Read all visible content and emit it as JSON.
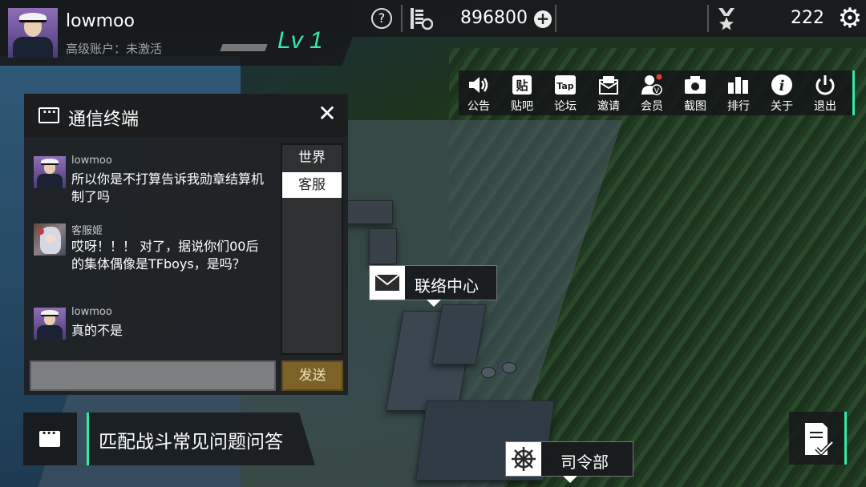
{
  "player": {
    "username": "lowmoo",
    "account_status": "高级账户：未激活",
    "level": "Lv 1"
  },
  "resources": {
    "help_label": "?",
    "coins": "896800",
    "medals": "222"
  },
  "menu": {
    "items": [
      {
        "label": "公告",
        "icon": "speaker-icon"
      },
      {
        "label": "贴吧",
        "icon": "tieba-icon"
      },
      {
        "label": "论坛",
        "icon": "taptap-icon"
      },
      {
        "label": "邀请",
        "icon": "invite-mail-icon"
      },
      {
        "label": "会员",
        "icon": "member-icon"
      },
      {
        "label": "截图",
        "icon": "camera-icon"
      },
      {
        "label": "排行",
        "icon": "ranking-icon"
      },
      {
        "label": "关于",
        "icon": "info-icon"
      },
      {
        "label": "退出",
        "icon": "power-icon"
      }
    ]
  },
  "chat": {
    "title": "通信终端",
    "close_label": "✕",
    "tabs": [
      "世界",
      "客服"
    ],
    "active_tab": "客服",
    "messages": [
      {
        "name": "lowmoo",
        "text": "所以你是不打算告诉我勋章结算机制了吗"
      },
      {
        "name": "客服姬",
        "text": "哎呀！！！ 对了，据说你们00后的集体偶像是TFboys，是吗？"
      },
      {
        "name": "lowmoo",
        "text": "真的不是"
      }
    ],
    "input_value": "",
    "send_label": "发送"
  },
  "faq": {
    "label": "匹配战斗常见问题问答"
  },
  "map_markers": {
    "contact": "联络中心",
    "hq": "司令部"
  },
  "colors": {
    "accent": "#35e8a6",
    "send_button": "#7b6226"
  }
}
